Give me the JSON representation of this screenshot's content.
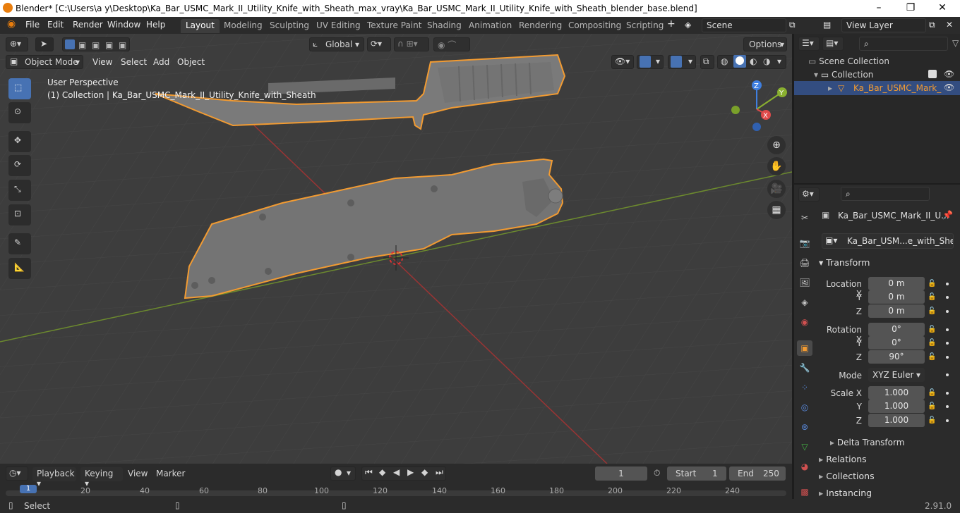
{
  "window": {
    "title": "Blender* [C:\\Users\\a y\\Desktop\\Ka_Bar_USMC_Mark_II_Utility_Knife_with_Sheath_max_vray\\Ka_Bar_USMC_Mark_II_Utility_Knife_with_Sheath_blender_base.blend]"
  },
  "menu": {
    "file": "File",
    "edit": "Edit",
    "render": "Render",
    "window": "Window",
    "help": "Help"
  },
  "workspaces": [
    "Layout",
    "Modeling",
    "Sculpting",
    "UV Editing",
    "Texture Paint",
    "Shading",
    "Animation",
    "Rendering",
    "Compositing",
    "Scripting"
  ],
  "scene": {
    "name": "Scene",
    "view_layer": "View Layer"
  },
  "viewport": {
    "transform_orientation": "Global",
    "options": "Options",
    "mode": "Object Mode",
    "menu_view": "View",
    "menu_select": "Select",
    "menu_add": "Add",
    "menu_object": "Object",
    "perspective": "User Perspective",
    "collection_info": "(1) Collection | Ka_Bar_USMC_Mark_II_Utility_Knife_with_Sheath",
    "gizmo": {
      "z": "Z",
      "y": "Y",
      "x": "X"
    }
  },
  "outliner": {
    "scene_collection": "Scene Collection",
    "collection": "Collection",
    "object": "Ka_Bar_USMC_Mark_"
  },
  "properties": {
    "object_name": "Ka_Bar_USMC_Mark_II_U...",
    "data_name": "Ka_Bar_USM...e_with_Sheath",
    "transform": "Transform",
    "location_label": "Location X",
    "y_label": "Y",
    "z_label": "Z",
    "rotation_label": "Rotation X",
    "mode_label": "Mode",
    "mode_value": "XYZ Euler",
    "scale_label": "Scale X",
    "location": {
      "x": "0 m",
      "y": "0 m",
      "z": "0 m"
    },
    "rotation": {
      "x": "0°",
      "y": "0°",
      "z": "90°"
    },
    "scale": {
      "x": "1.000",
      "y": "1.000",
      "z": "1.000"
    },
    "delta_transform": "Delta Transform",
    "relations": "Relations",
    "collections": "Collections",
    "instancing": "Instancing"
  },
  "timeline": {
    "playback": "Playback",
    "keying": "Keying",
    "view": "View",
    "marker": "Marker",
    "current_frame": "1",
    "start_label": "Start",
    "start": "1",
    "end_label": "End",
    "end": "250",
    "ticks": [
      "1",
      "20",
      "40",
      "60",
      "80",
      "100",
      "120",
      "140",
      "160",
      "180",
      "200",
      "220",
      "240"
    ]
  },
  "status": {
    "select": "Select",
    "version": "2.91.0"
  },
  "colors": {
    "accent": "#4772b3",
    "selection": "#f29b32",
    "orange": "#e87d0d"
  }
}
